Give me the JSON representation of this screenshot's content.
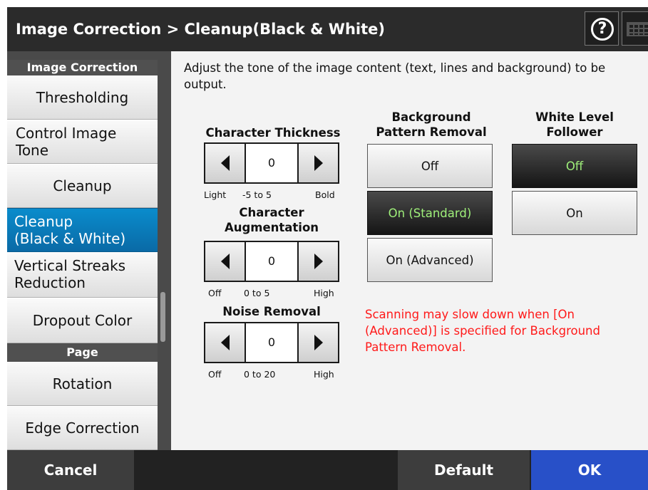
{
  "header": {
    "title": "Image Correction > Cleanup(Black & White)",
    "help_icon": "?"
  },
  "sidebar": {
    "section1": "Image Correction",
    "items1": [
      "Thresholding",
      "Control Image Tone",
      "Cleanup",
      "Cleanup (Black & White)",
      "Vertical Streaks Reduction",
      "Dropout Color"
    ],
    "item_lines": {
      "control_1": "Control Image",
      "control_2": "Tone",
      "cleanup_bw_1": "Cleanup",
      "cleanup_bw_2": "(Black & White)",
      "vsr_1": "Vertical Streaks",
      "vsr_2": "Reduction"
    },
    "section2": "Page",
    "items2": [
      "Rotation",
      "Edge Correction"
    ],
    "active": "Cleanup (Black & White)"
  },
  "main": {
    "description_1": "Adjust the tone of the image content (text, lines and background) to be",
    "description_2": "output.",
    "character_thickness": {
      "title": "Character Thickness",
      "value": "0",
      "min_label": "Light",
      "range_label": "-5 to 5",
      "max_label": "Bold"
    },
    "character_augmentation": {
      "title_1": "Character",
      "title_2": "Augmentation",
      "value": "0",
      "min_label": "Off",
      "range_label": "0 to 5",
      "max_label": "High"
    },
    "noise_removal": {
      "title": "Noise Removal",
      "value": "0",
      "min_label": "Off",
      "range_label": "0 to 20",
      "max_label": "High"
    },
    "background_pattern_removal": {
      "title_1": "Background",
      "title_2": "Pattern Removal",
      "options": [
        "Off",
        "On (Standard)",
        "On (Advanced)"
      ],
      "selected": "On (Standard)"
    },
    "white_level_follower": {
      "title_1": "White Level",
      "title_2": "Follower",
      "options": [
        "Off",
        "On"
      ],
      "selected": "Off"
    },
    "warning_1": "Scanning may slow down when [On",
    "warning_2": "(Advanced)] is specified for Background",
    "warning_3": "Pattern Removal."
  },
  "footer": {
    "cancel": "Cancel",
    "default": "Default",
    "ok": "OK"
  },
  "colors": {
    "selected_text": "#9ff07a",
    "active_sidebar": "#0a7ab8",
    "ok_button": "#2850c8",
    "warning": "#ff1a1a"
  }
}
